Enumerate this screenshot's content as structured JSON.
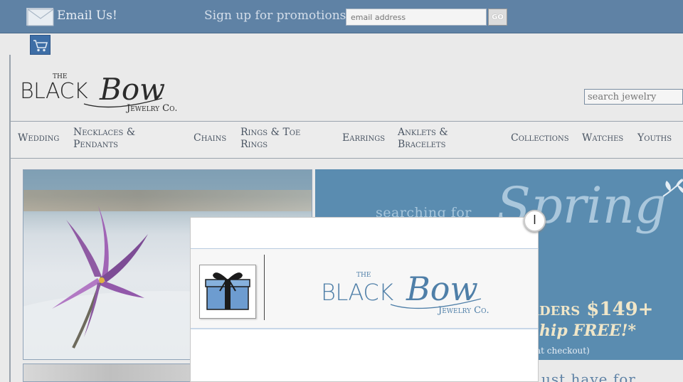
{
  "topbar": {
    "email_us": "Email Us!",
    "promo_text": "Sign up for promotions",
    "email_placeholder": "email address",
    "go_label": "GO"
  },
  "header": {
    "logo_the": "THE",
    "logo_black": "BLACK",
    "logo_bow": "Bow",
    "logo_co": "Jewelry Co.",
    "search_placeholder": "search jewelry"
  },
  "nav": {
    "items": [
      {
        "line1": "Wedding",
        "line2": ""
      },
      {
        "line1": "Necklaces &",
        "line2": "Pendants"
      },
      {
        "line1": "Chains",
        "line2": ""
      },
      {
        "line1": "Rings & Toe",
        "line2": "Rings"
      },
      {
        "line1": "Earrings",
        "line2": ""
      },
      {
        "line1": "Anklets &",
        "line2": "Bracelets"
      },
      {
        "line1": "Collections",
        "line2": ""
      },
      {
        "line1": "Watches",
        "line2": ""
      },
      {
        "line1": "Youths",
        "line2": ""
      }
    ]
  },
  "banner": {
    "text1": "searching for",
    "spring": "Spring",
    "orders": "rders $149+",
    "ship": "hip FREE!*",
    "checkout": "at checkout)",
    "bottom_text": "ust have for"
  },
  "modal": {
    "close_label": "l",
    "logo_the": "THE",
    "logo_black": "BLACK",
    "logo_bow": "Bow",
    "logo_co": "Jewelry Co."
  },
  "colors": {
    "topbar": "#5f82a5",
    "accent_blue": "#5a8cb0",
    "logo_dark": "#2b2b2b",
    "logo_blue": "#4f7fa8"
  }
}
